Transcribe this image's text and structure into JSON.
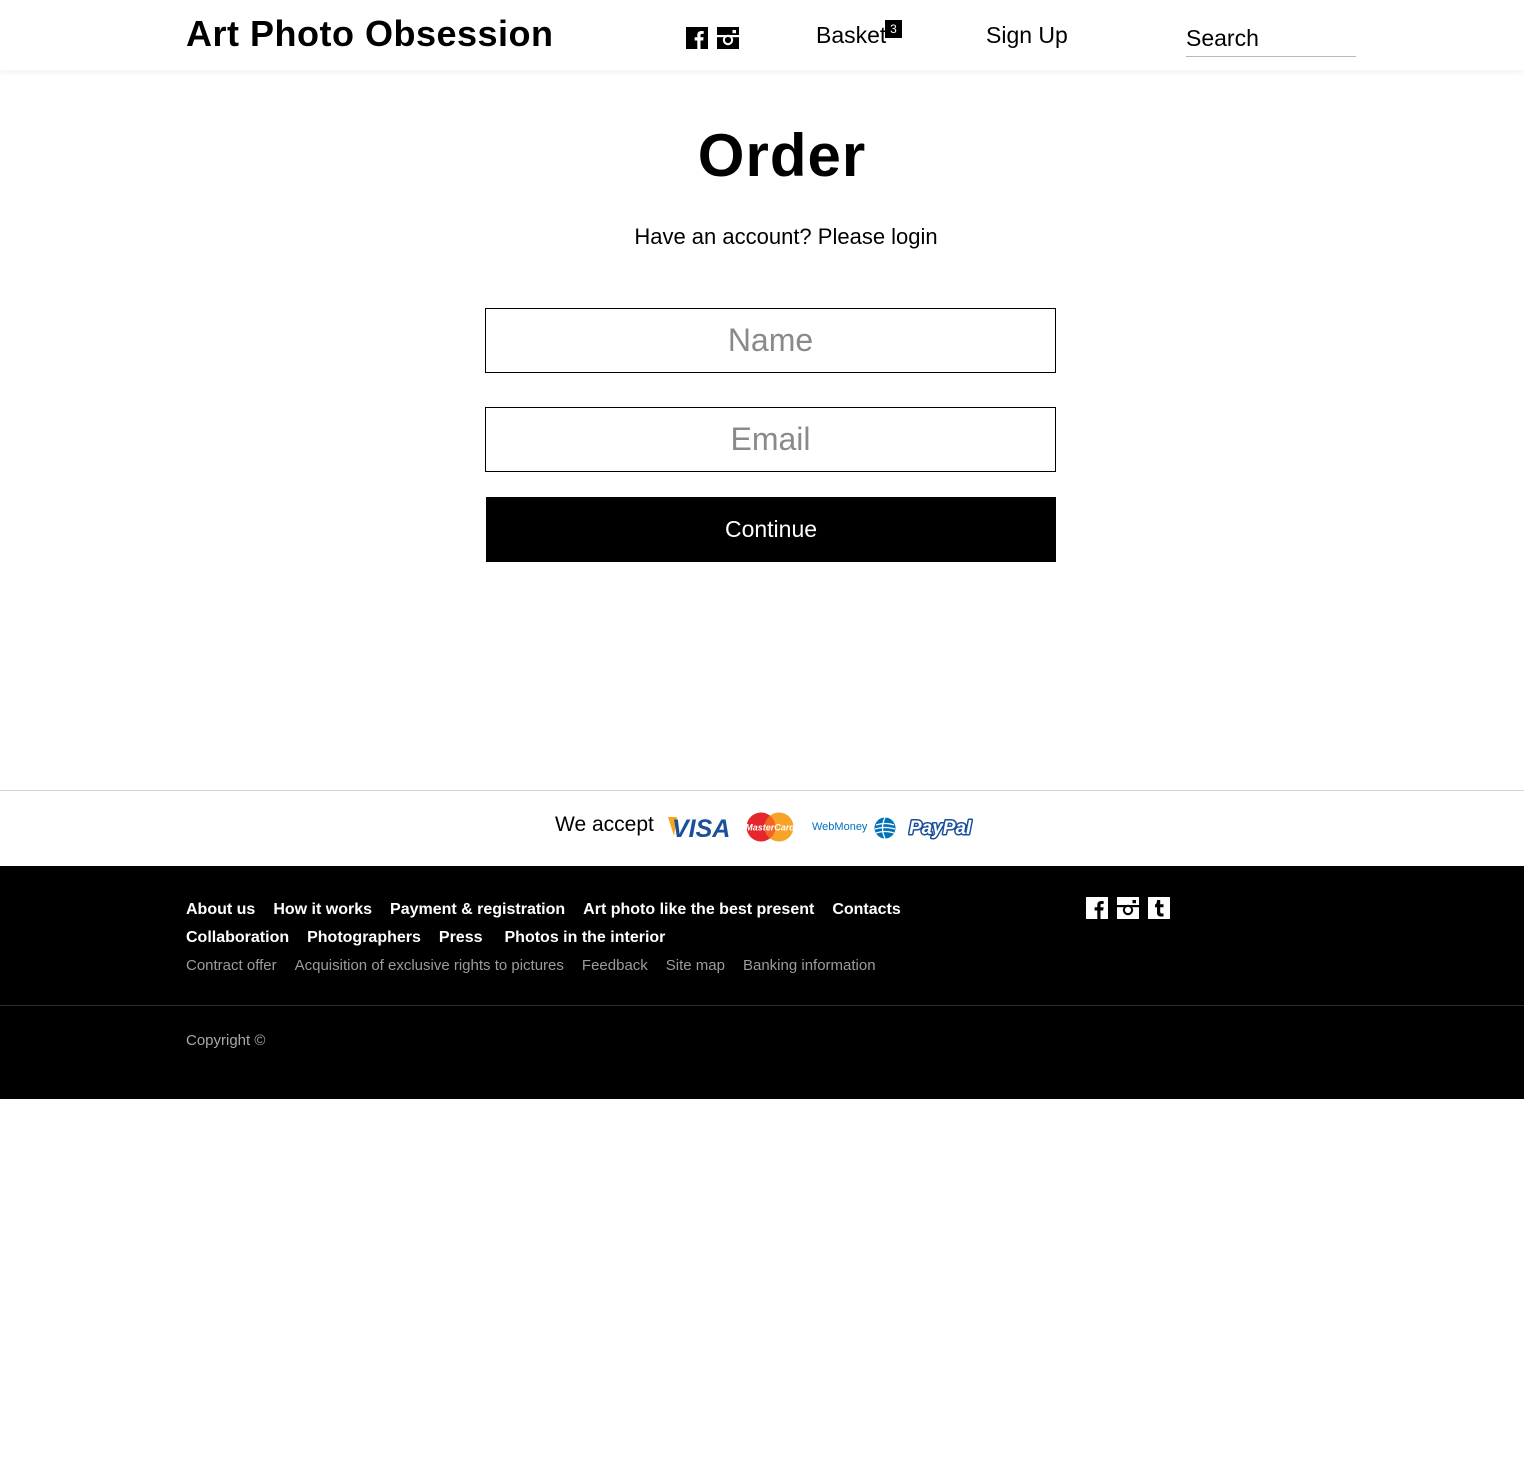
{
  "header": {
    "logo": "Art Photo Obsession",
    "basket_label": "Basket",
    "basket_count": "3",
    "signup_label": "Sign Up",
    "search_placeholder": "Search",
    "social_icons": [
      "facebook-icon",
      "instagram-icon"
    ]
  },
  "main": {
    "title": "Order",
    "login_prompt": "Have an account? Please login",
    "name_placeholder": "Name",
    "email_placeholder": "Email",
    "continue_label": "Continue"
  },
  "payments": {
    "label": "We accept",
    "methods": [
      "VISA",
      "MasterCard",
      "WebMoney",
      "PayPal"
    ]
  },
  "footer": {
    "nav_primary_1": [
      "About us",
      "How it works",
      "Payment & registration",
      "Art photo like the best present",
      "Contacts"
    ],
    "nav_primary_2": [
      "Collaboration",
      "Photographers",
      "Press",
      "Photos in the interior"
    ],
    "nav_secondary": [
      "Contract offer",
      "Acquisition of exclusive rights to pictures",
      "Feedback",
      "Site map",
      "Banking information"
    ],
    "social_icons": [
      "facebook-icon",
      "instagram-icon",
      "tumblr-icon"
    ],
    "copyright": "Copyright ©"
  },
  "colors": {
    "accent": "#000000",
    "background": "#ffffff",
    "visa_blue": "#1a4f9c",
    "mastercard_red": "#e5262c",
    "mastercard_orange": "#f79e1b",
    "webmoney_blue": "#0071bb",
    "paypal_blue": "#1a4f9c"
  }
}
